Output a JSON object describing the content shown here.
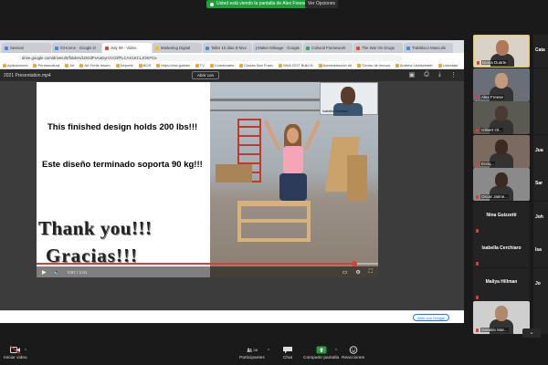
{
  "banner": {
    "share_label": "Usted está viendo la pantalla de Alex Freese",
    "view_options": "Ver Opciones"
  },
  "browser": {
    "tabs": [
      {
        "label": "Session",
        "color": "#4285f4",
        "active": false
      },
      {
        "label": "ICHonne - Google D",
        "color": "#4285f4",
        "active": false
      },
      {
        "label": "July 08 - Video",
        "color": "#ea4335",
        "active": true
      },
      {
        "label": "Marketing Digital",
        "color": "#fbbc05",
        "active": false
      },
      {
        "label": "Taller 10 días 8 Nivo",
        "color": "#4285f4",
        "active": false
      },
      {
        "label": "Maker Mileage - Google",
        "color": "#4285f4",
        "active": false
      },
      {
        "label": "Cultural Framework",
        "color": "#34a853",
        "active": false
      },
      {
        "label": "The War On Drugs",
        "color": "#ea4335",
        "active": false
      },
      {
        "label": "Trabbloco Masculin",
        "color": "#4285f4",
        "active": false
      }
    ],
    "url": "drive.google.com/drive/u/0/folders/1DGdFsAaGyrcCCDfFLCAX1KCLJOKFCe",
    "bookmarks": [
      "Aplicaciones",
      "Permacultura",
      "Art",
      "Art Fretis Insum",
      "Deporte",
      "BOS",
      "https://ess.gobiab",
      "TV",
      "Comarcales",
      "Ciudas San Franc",
      "0800 DOT Build N",
      "Administración de",
      "Centro de innova",
      "Andrew Lewiscenter",
      "Leamtakr"
    ]
  },
  "viewer": {
    "file_name": "2021 Presentation.mp4",
    "open_with": "Abrir con"
  },
  "video": {
    "line1": "This finished design holds 200 lbs!!!",
    "line2": "Este diseño terminado soporta 90 kg!!!",
    "thanks": "Thank you!!!",
    "gracias": "Gracias!!!",
    "pip_name": "Isabella Cerchiaro",
    "progress": 0.93,
    "time": "0:57 / 1:01"
  },
  "doc_bottom": {
    "pill": "Abrir con Google"
  },
  "gallery": {
    "tiles": [
      {
        "name": "Diana Duarte",
        "active": true,
        "type": "video",
        "face": "#b07a5a",
        "bg": "#d9d2c7"
      },
      {
        "name": "Alex Freese",
        "active": false,
        "type": "video",
        "face": "#c49a7a",
        "bg": "#6a6e78"
      },
      {
        "name": "Gilbert Ol...",
        "active": false,
        "type": "video",
        "face": "#4a3a30",
        "bg": "#5a5a52"
      },
      {
        "name": "Enriq...",
        "active": false,
        "type": "video",
        "face": "#3a2a22",
        "bg": "#7a6a60"
      },
      {
        "name": "Oscar Jaime...",
        "active": false,
        "type": "video",
        "face": "#3a2a22",
        "bg": "#8a8a8a"
      },
      {
        "name": "Nina Guizzetti",
        "active": false,
        "type": "name"
      },
      {
        "name": "Isabella Cerchiaro",
        "active": false,
        "type": "name"
      },
      {
        "name": "Maliya Hillman",
        "active": false,
        "type": "name"
      },
      {
        "name": "Geraldo Mar...",
        "active": false,
        "type": "video",
        "face": "#b08a68",
        "bg": "#cfcfcf"
      }
    ],
    "side": [
      "Cata",
      "",
      "",
      "Jua",
      "Sar",
      "Joh",
      "Isa",
      "Jo",
      ""
    ]
  },
  "toolbar": {
    "video_label": "Iniciar video",
    "participants_label": "Participantes",
    "participants_count": "28",
    "chat_label": "Chat",
    "share_label": "Compartir pantalla",
    "reactions_label": "Reacciones"
  },
  "colors": {
    "accent_green": "#1f9e3c",
    "progress_red": "#e53935",
    "active_speaker": "#e8c84a"
  }
}
